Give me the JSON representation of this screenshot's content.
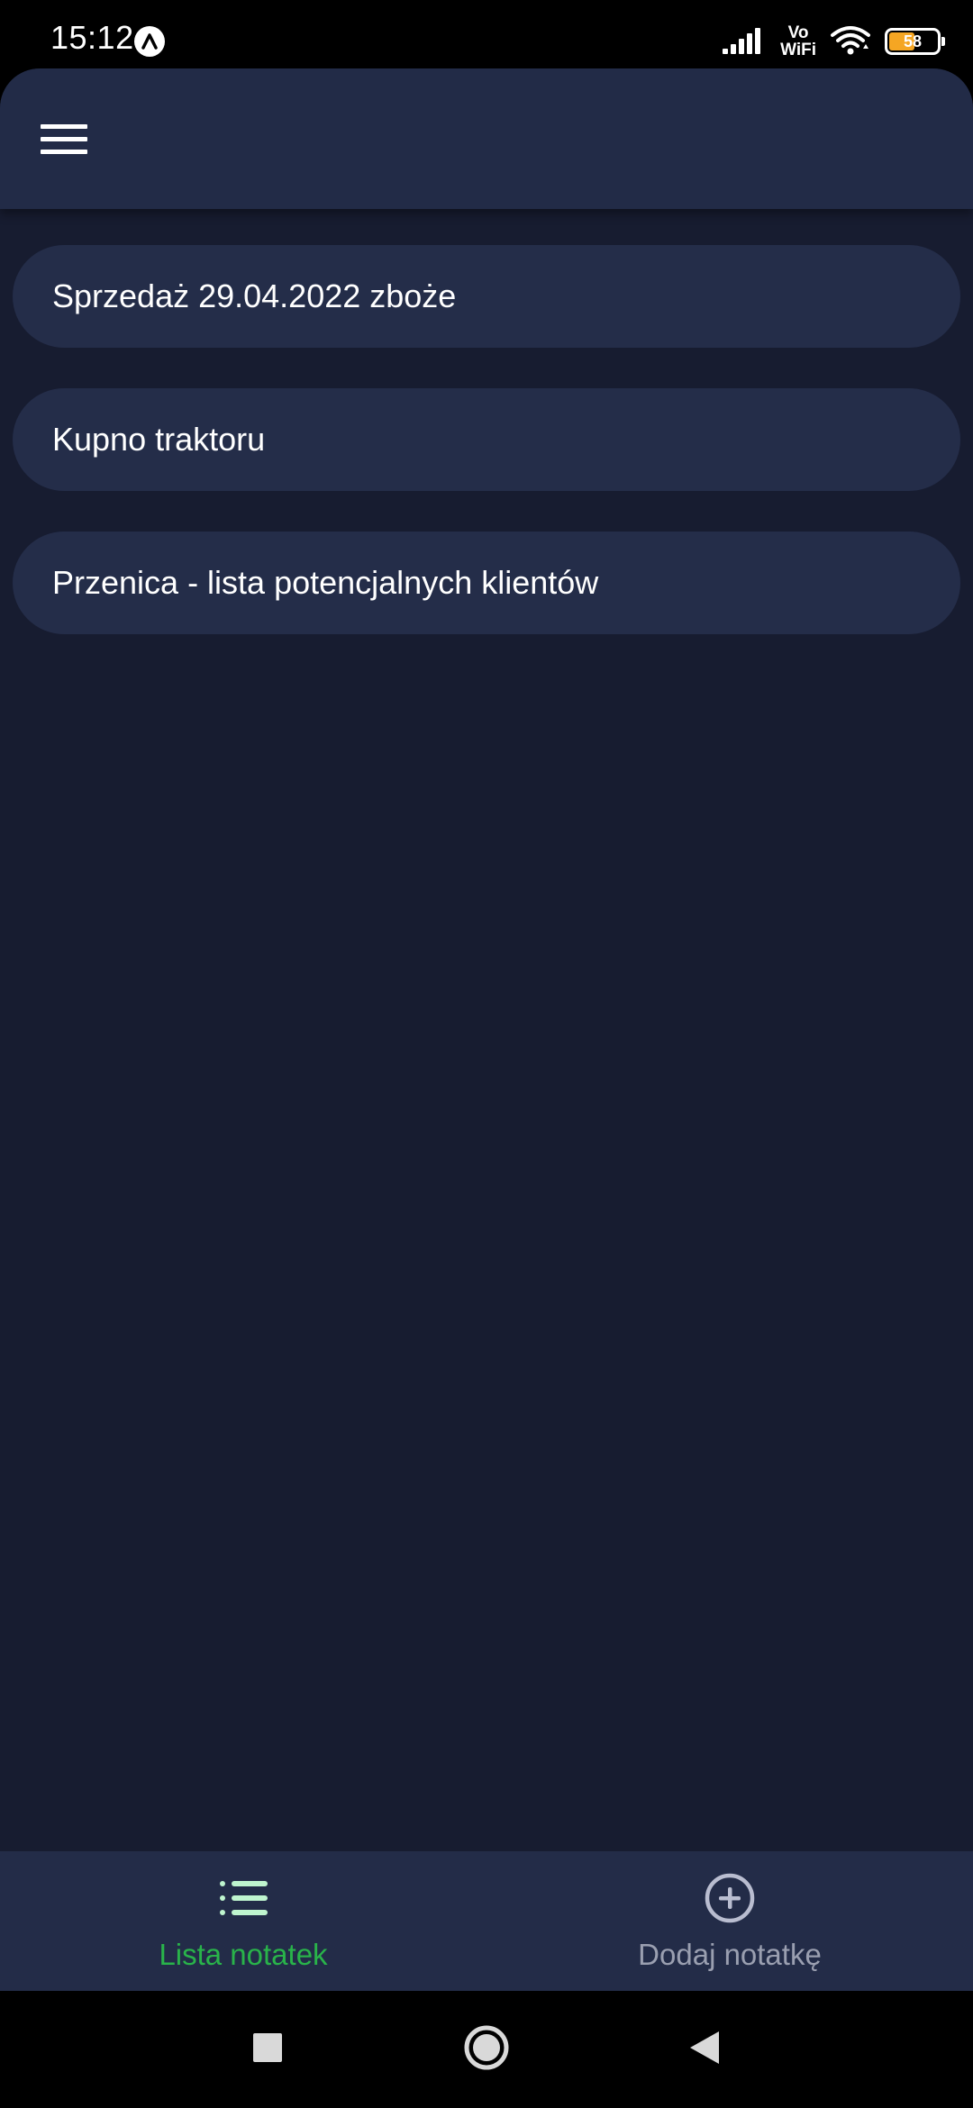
{
  "status_bar": {
    "time": "15:12",
    "network_label_top": "Vo",
    "network_label_bottom": "WiFi",
    "battery_percent": "58",
    "battery_level": 0.58,
    "icons": [
      "notification-app-icon",
      "signal-icon",
      "wifi-icon",
      "battery-icon"
    ]
  },
  "header": {
    "menu_icon": "hamburger-menu-icon"
  },
  "notes": [
    {
      "title": "Sprzedaż 29.04.2022 zboże"
    },
    {
      "title": "Kupno traktoru"
    },
    {
      "title": "Przenica - lista potencjalnych klientów"
    }
  ],
  "bottom_nav": {
    "tabs": [
      {
        "label": "Lista notatek",
        "icon": "list-icon",
        "active": true
      },
      {
        "label": "Dodaj notatkę",
        "icon": "add-circle-icon",
        "active": false
      }
    ]
  },
  "system_nav": {
    "icons": [
      "recent-apps-icon",
      "home-icon",
      "back-icon"
    ]
  },
  "colors": {
    "background": "#171c30",
    "surface": "#222b47",
    "card": "#242d49",
    "accent_green": "#29b34a",
    "inactive_text": "#9a9fb0",
    "active_icon": "#bff5cf"
  }
}
